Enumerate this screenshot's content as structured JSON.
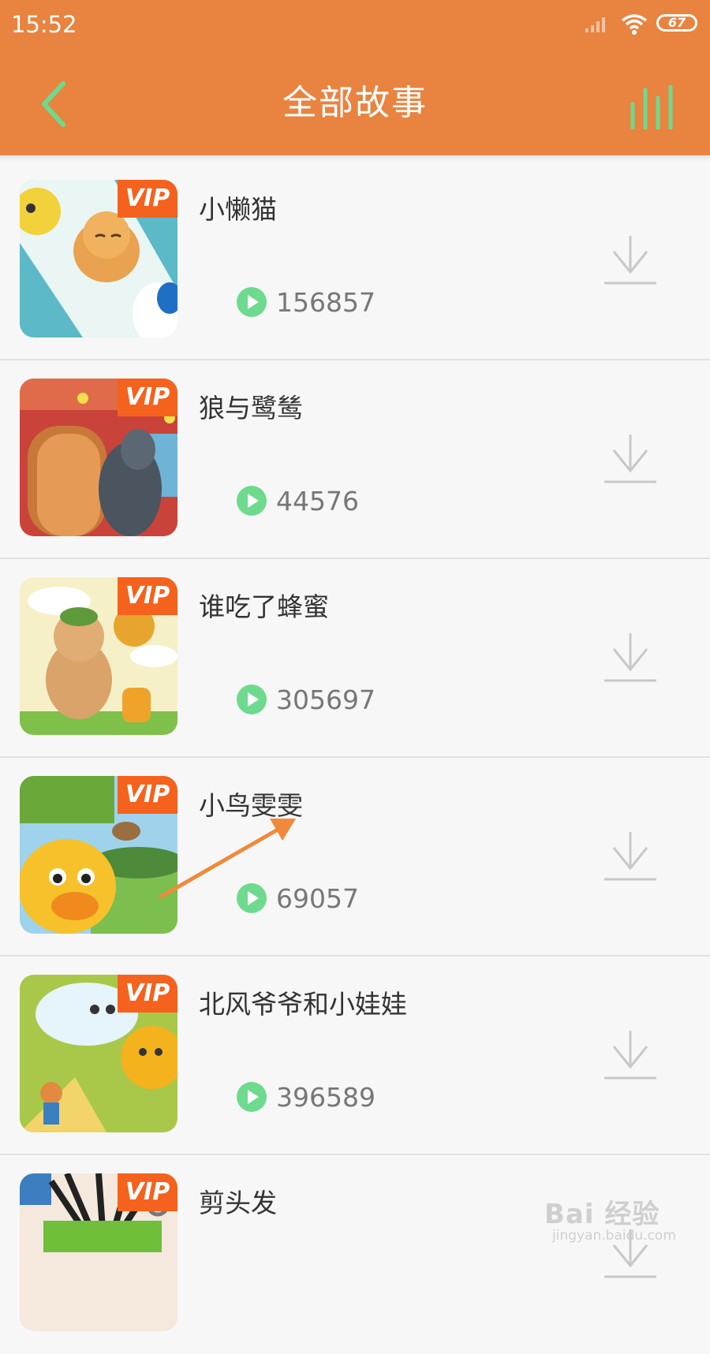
{
  "status_bar": {
    "time": "15:52",
    "battery": "67"
  },
  "header": {
    "title": "全部故事"
  },
  "badge": {
    "vip": "VIP"
  },
  "stories": [
    {
      "title": "小懒猫",
      "plays": "156857"
    },
    {
      "title": "狼与鹭鸶",
      "plays": "44576"
    },
    {
      "title": "谁吃了蜂蜜",
      "plays": "305697"
    },
    {
      "title": "小鸟雯雯",
      "plays": "69057"
    },
    {
      "title": "北风爷爷和小娃娃",
      "plays": "396589"
    },
    {
      "title": "剪头发",
      "plays": ""
    }
  ],
  "watermark": {
    "brand": "Bai 经验",
    "url": "jingyan.baidu.com"
  },
  "colors": {
    "header": "#E98340",
    "accent_green": "#6DDA8E",
    "vip": "#F5621D"
  },
  "icons": [
    "back-arrow-icon",
    "equalizer-icon",
    "play-icon",
    "download-icon",
    "signal-icon",
    "wifi-icon",
    "battery-icon"
  ]
}
